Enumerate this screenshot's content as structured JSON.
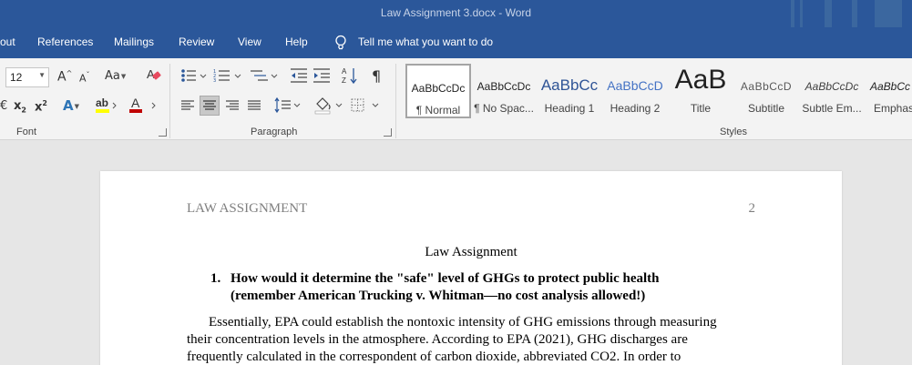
{
  "window": {
    "title": "Law Assignment 3.docx  -  Word"
  },
  "ribbon_tabs": [
    "out",
    "References",
    "Mailings",
    "Review",
    "View",
    "Help"
  ],
  "tell_me": {
    "label": "Tell me what you want to do",
    "icon": "lightbulb-icon"
  },
  "font_group": {
    "label": "Font",
    "font_size": "12",
    "grow_font": "A",
    "shrink_font": "A",
    "change_case": "Aa",
    "subscript": "x",
    "subscript_mark": "2",
    "superscript": "x",
    "superscript_mark": "2",
    "text_effects": "A",
    "font_color": "A",
    "font_color_value": "#c00000",
    "highlight_color_value": "#ffff00"
  },
  "paragraph_group": {
    "label": "Paragraph",
    "pilcrow": "¶"
  },
  "styles_group": {
    "label": "Styles",
    "items": [
      {
        "sample": "AaBbCcDc",
        "name": "¶ Normal"
      },
      {
        "sample": "AaBbCcDc",
        "name": "¶ No Spac..."
      },
      {
        "sample": "AaBbCc",
        "name": "Heading 1"
      },
      {
        "sample": "AaBbCcD",
        "name": "Heading 2"
      },
      {
        "sample": "AaB",
        "name": "Title"
      },
      {
        "sample": "AaBbCcD",
        "name": "Subtitle"
      },
      {
        "sample": "AaBbCcDc",
        "name": "Subtle Em..."
      },
      {
        "sample": "AaBbCc",
        "name": "Emphas"
      }
    ]
  },
  "colors": {
    "title_bar": "#2b579a",
    "heading_blue": "#2f5496",
    "heading2_blue": "#4472c4"
  },
  "document": {
    "header_left": "LAW ASSIGNMENT",
    "page_number": "2",
    "title": "Law Assignment",
    "question_number": "1.",
    "question_lines": [
      "How would it determine the \"safe\" level of GHGs to protect public health",
      "(remember American Trucking v. Whitman—no cost analysis allowed!)"
    ],
    "paragraph_lines": [
      "Essentially, EPA could establish the nontoxic intensity of GHG emissions through measuring",
      "their concentration levels in the atmosphere. According to EPA (2021), GHG discharges are",
      "frequently calculated in the correspondent of carbon dioxide, abbreviated CO2. In order to"
    ]
  }
}
